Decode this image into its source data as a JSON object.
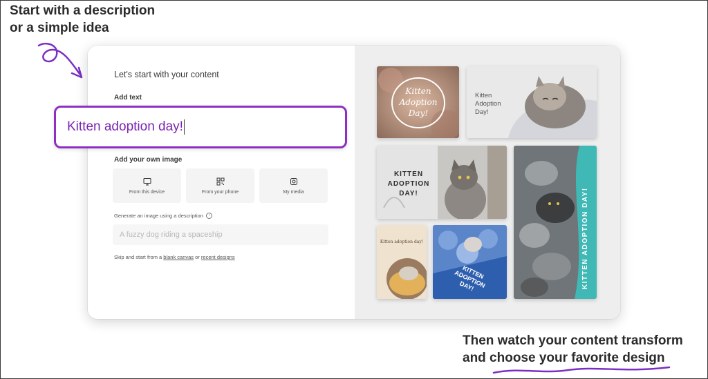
{
  "annotations": {
    "top_line1": "Start with a description",
    "top_line2": "or a simple idea",
    "bottom_line1": "Then watch your content transform",
    "bottom_line2": "and choose your favorite design",
    "pen_color": "#7b2ec4"
  },
  "panel": {
    "heading": "Let's start with your content",
    "add_text_label": "Add text",
    "text_value": "Kitten adoption day!",
    "add_image_label": "Add your own image",
    "image_sources": [
      {
        "label": "From this device",
        "icon": "monitor-icon"
      },
      {
        "label": "From your phone",
        "icon": "qr-code-icon"
      },
      {
        "label": "My media",
        "icon": "media-icon"
      }
    ],
    "generate_label": "Generate an image using a description",
    "generate_placeholder": "A fuzzy dog riding a spaceship",
    "skip_prefix": "Skip and start from a ",
    "skip_link1": "blank canvas",
    "skip_mid": " or ",
    "skip_link2": "recent designs"
  },
  "designs": {
    "d1_text": [
      "Kitten",
      "Adoption",
      "Day!"
    ],
    "d2_text": [
      "Kitten",
      "Adoption",
      "Day!"
    ],
    "d3_text": [
      "KITTEN",
      "ADOPTION",
      "DAY!"
    ],
    "d4_text": "KITTEN ADOPTION DAY!",
    "d5_text": "Kitten adoption day!",
    "d6_text": [
      "KITTEN",
      "ADOPTION",
      "DAY!"
    ]
  },
  "colors": {
    "accent": "#8e2ec2",
    "input_text": "#7d22b2",
    "teal": "#2aa9b0"
  }
}
